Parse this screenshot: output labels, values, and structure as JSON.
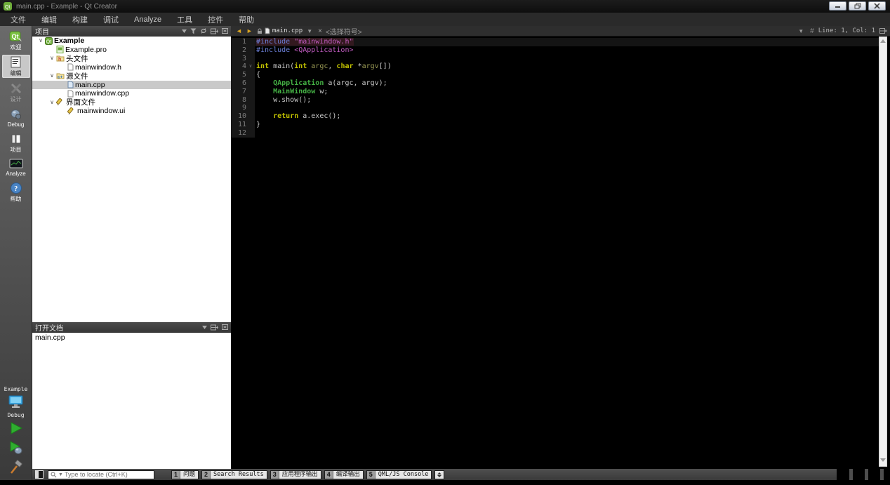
{
  "window": {
    "title": "main.cpp - Example - Qt Creator"
  },
  "menu_items": [
    "文件",
    "编辑",
    "构建",
    "调试",
    "Analyze",
    "工具",
    "控件",
    "帮助"
  ],
  "modes": [
    {
      "label": "欢迎",
      "icon": "welcome-qt",
      "state": "normal"
    },
    {
      "label": "编辑",
      "icon": "edit-mode",
      "state": "selected"
    },
    {
      "label": "设计",
      "icon": "design-mode",
      "state": "disabled"
    },
    {
      "label": "Debug",
      "icon": "debug-mode",
      "state": "normal"
    },
    {
      "label": "项目",
      "icon": "projects-mode",
      "state": "normal"
    },
    {
      "label": "Analyze",
      "icon": "analyze-mode",
      "state": "normal"
    },
    {
      "label": "帮助",
      "icon": "help-mode",
      "state": "normal"
    }
  ],
  "kit_selector": {
    "project": "Example",
    "config": "Debug"
  },
  "projects_panel": {
    "title": "项目",
    "tree": [
      {
        "label": "Example",
        "icon": "qt-project",
        "level": 0,
        "chevron": true,
        "bold": true,
        "selected": false
      },
      {
        "label": "Example.pro",
        "icon": "pro-file",
        "level": 1,
        "chevron": false,
        "bold": false,
        "selected": false
      },
      {
        "label": "头文件",
        "icon": "folder-h",
        "level": 1,
        "chevron": true,
        "bold": false,
        "selected": false
      },
      {
        "label": "mainwindow.h",
        "icon": "plain-file",
        "level": 2,
        "chevron": false,
        "bold": false,
        "selected": false
      },
      {
        "label": "源文件",
        "icon": "folder-cpp",
        "level": 1,
        "chevron": true,
        "bold": false,
        "selected": false
      },
      {
        "label": "main.cpp",
        "icon": "cpp-file",
        "level": 2,
        "chevron": false,
        "bold": false,
        "selected": true
      },
      {
        "label": "mainwindow.cpp",
        "icon": "plain-file",
        "level": 2,
        "chevron": false,
        "bold": false,
        "selected": false
      },
      {
        "label": "界面文件",
        "icon": "ui-pencil",
        "level": 1,
        "chevron": true,
        "bold": false,
        "selected": false
      },
      {
        "label": "mainwindow.ui",
        "icon": "ui-pencil",
        "level": 2,
        "chevron": false,
        "bold": false,
        "selected": false
      }
    ]
  },
  "open_documents_panel": {
    "title": "打开文档",
    "items": [
      "main.cpp"
    ]
  },
  "editor": {
    "filename": "main.cpp",
    "symbol_selector": "<选择符号>",
    "cursor_position": "Line: 1, Col: 1",
    "code_lines": [
      {
        "n": 1,
        "hl": true,
        "fold": false,
        "tokens": [
          [
            "pp",
            "#include"
          ],
          [
            "plain",
            " "
          ],
          [
            "str",
            "\"mainwindow.h\""
          ]
        ]
      },
      {
        "n": 2,
        "hl": false,
        "fold": false,
        "tokens": [
          [
            "pp",
            "#include"
          ],
          [
            "plain",
            " "
          ],
          [
            "str",
            "<QApplication>"
          ]
        ]
      },
      {
        "n": 3,
        "hl": false,
        "fold": false,
        "tokens": []
      },
      {
        "n": 4,
        "hl": false,
        "fold": true,
        "tokens": [
          [
            "kw",
            "int"
          ],
          [
            "plain",
            " main("
          ],
          [
            "kw",
            "int"
          ],
          [
            "plain",
            " "
          ],
          [
            "param",
            "argc"
          ],
          [
            "plain",
            ", "
          ],
          [
            "kw",
            "char"
          ],
          [
            "plain",
            " *"
          ],
          [
            "param",
            "argv"
          ],
          [
            "plain",
            "[])"
          ]
        ]
      },
      {
        "n": 5,
        "hl": false,
        "fold": false,
        "tokens": [
          [
            "plain",
            "{"
          ]
        ]
      },
      {
        "n": 6,
        "hl": false,
        "fold": false,
        "tokens": [
          [
            "plain",
            "    "
          ],
          [
            "type",
            "QApplication"
          ],
          [
            "plain",
            " a(argc, argv);"
          ]
        ]
      },
      {
        "n": 7,
        "hl": false,
        "fold": false,
        "tokens": [
          [
            "plain",
            "    "
          ],
          [
            "type",
            "MainWindow"
          ],
          [
            "plain",
            " w;"
          ]
        ]
      },
      {
        "n": 8,
        "hl": false,
        "fold": false,
        "tokens": [
          [
            "plain",
            "    w.show();"
          ]
        ]
      },
      {
        "n": 9,
        "hl": false,
        "fold": false,
        "tokens": []
      },
      {
        "n": 10,
        "hl": false,
        "fold": false,
        "tokens": [
          [
            "plain",
            "    "
          ],
          [
            "kw",
            "return"
          ],
          [
            "plain",
            " a.exec();"
          ]
        ]
      },
      {
        "n": 11,
        "hl": false,
        "fold": false,
        "tokens": [
          [
            "plain",
            "}"
          ]
        ]
      },
      {
        "n": 12,
        "hl": false,
        "fold": false,
        "tokens": []
      }
    ]
  },
  "locator": {
    "placeholder": "Type to locate (Ctrl+K)"
  },
  "output_panes": [
    {
      "num": "1",
      "label": "问题"
    },
    {
      "num": "2",
      "label": "Search Results"
    },
    {
      "num": "3",
      "label": "应用程序输出"
    },
    {
      "num": "4",
      "label": "编译输出"
    },
    {
      "num": "5",
      "label": "QML/JS Console"
    }
  ],
  "colors": {
    "keyword": "#c0c000",
    "type": "#44b044",
    "string": "#c35dc3",
    "preprocessor": "#6b7fd7",
    "parameter": "#9a9a55",
    "default_text": "#c8c8c8",
    "current_line_text_bg": "#33191f",
    "run_green": "#2fae2f",
    "hammer_orange": "#c87a2e",
    "selection_gray": "#c9c9c9"
  }
}
